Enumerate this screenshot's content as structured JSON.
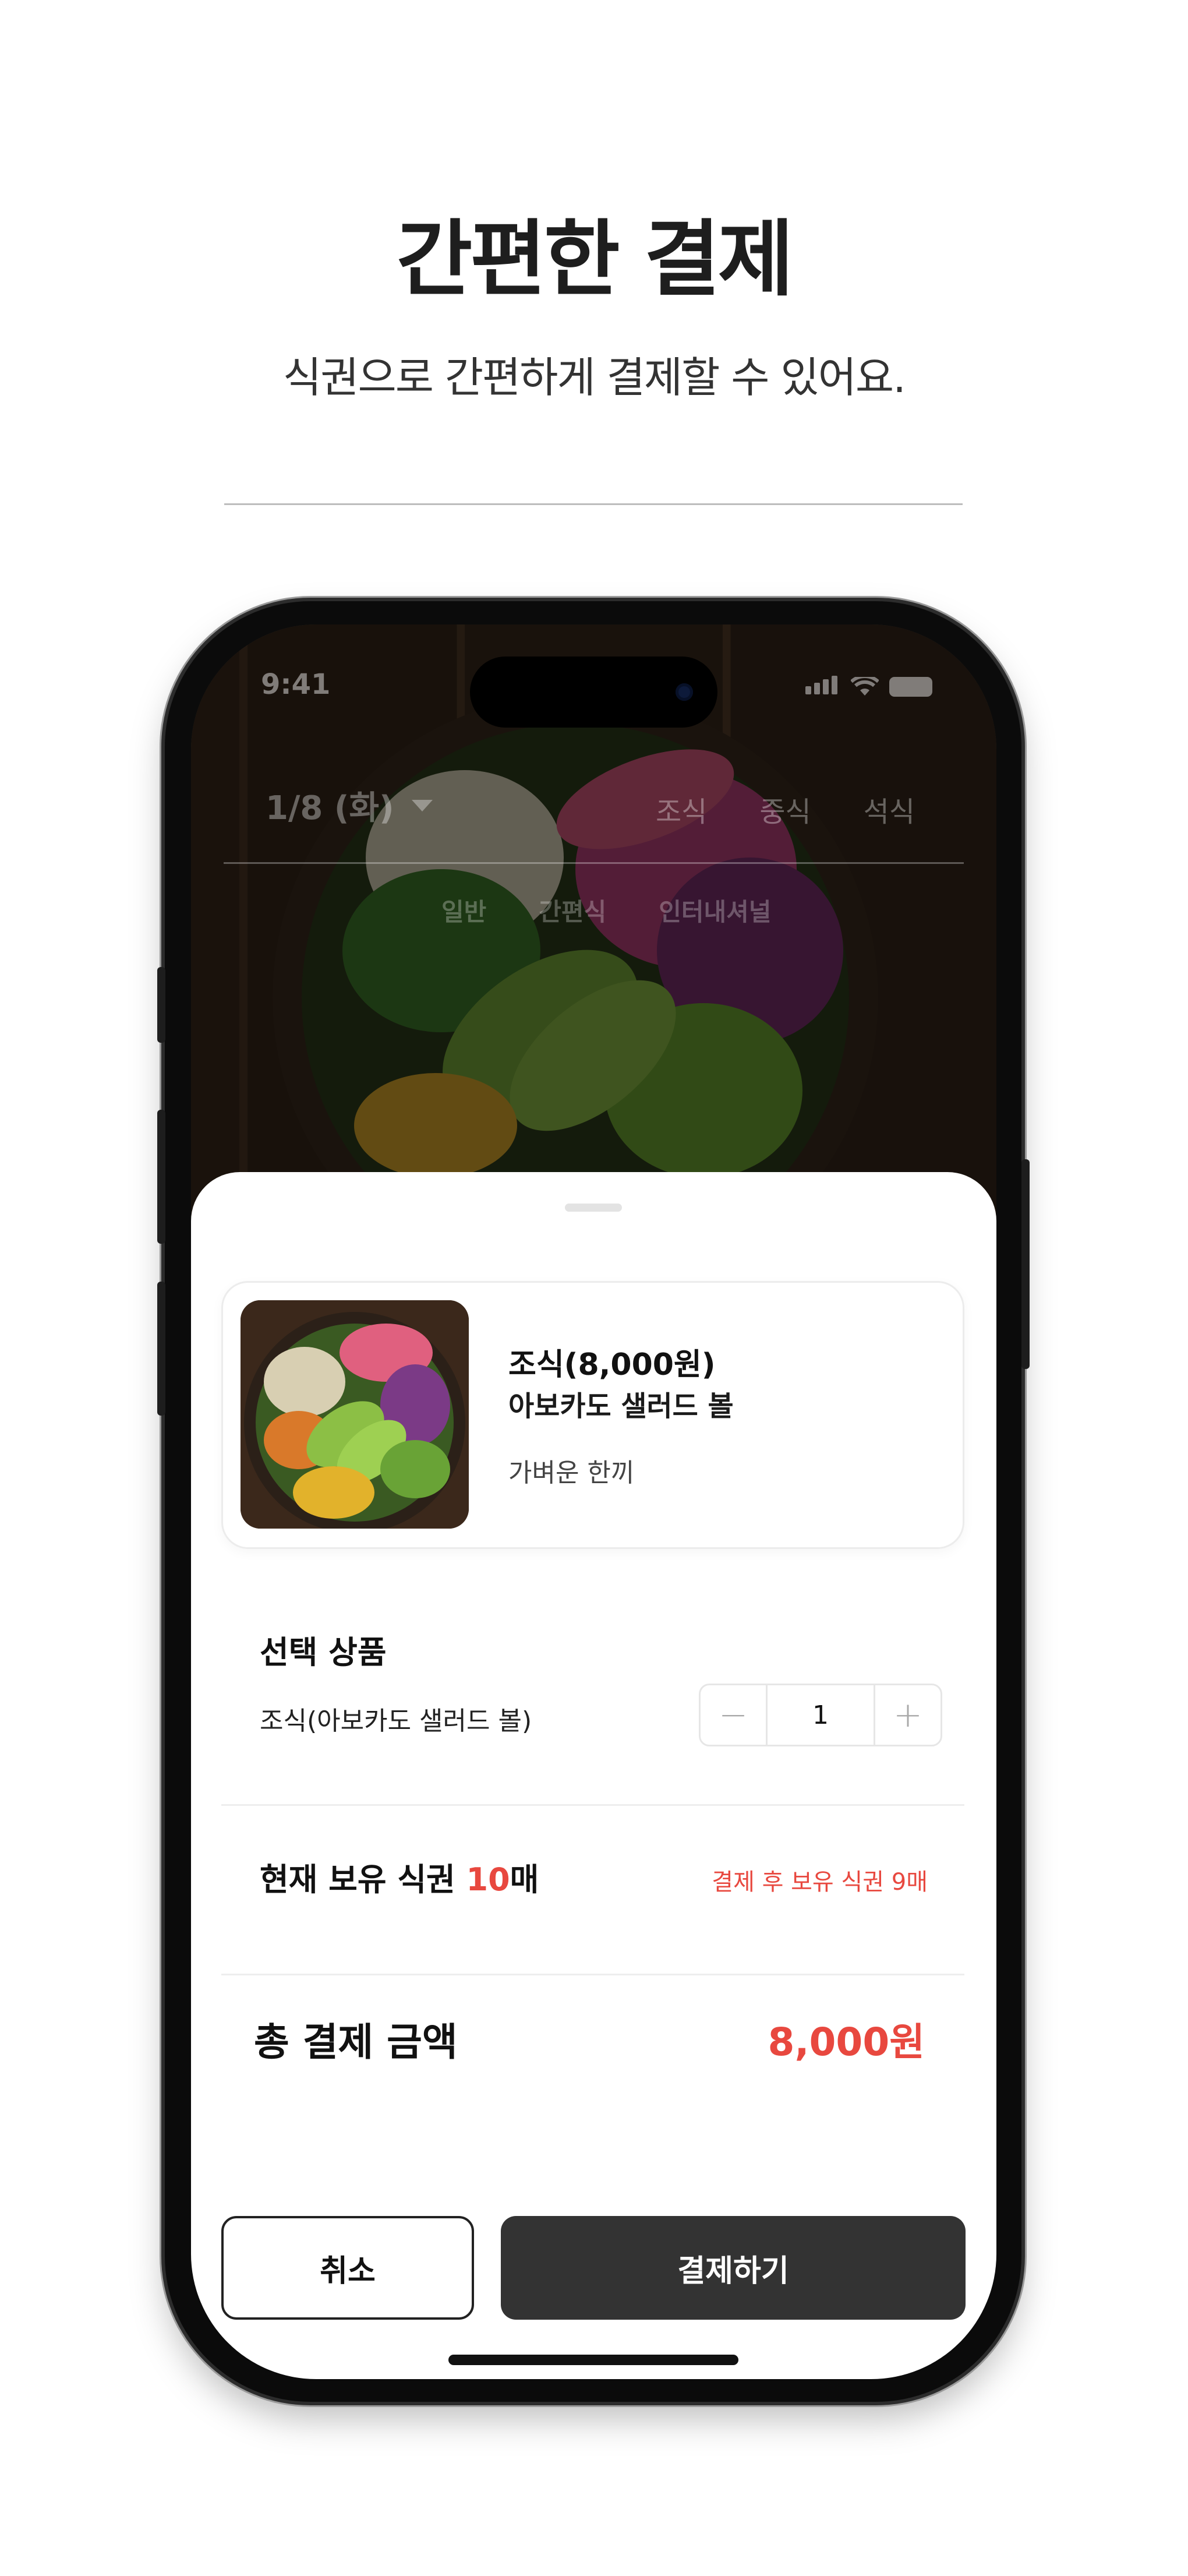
{
  "hero": {
    "title": "간편한 결제",
    "subtitle": "식권으로 간편하게 결제할 수 있어요."
  },
  "status_bar": {
    "time": "9:41",
    "icons": [
      "signal-icon",
      "wifi-icon",
      "battery-icon"
    ]
  },
  "app_header": {
    "date": "1/8 (화)",
    "meal_tabs": [
      "조식",
      "중식",
      "석식"
    ],
    "sub_tabs": [
      "일반",
      "간편식",
      "인터내셔널"
    ]
  },
  "sheet": {
    "product": {
      "meal": "조식(8,000원)",
      "name": "아보카도 샐러드 볼",
      "description": "가벼운 한끼"
    },
    "selection": {
      "title": "선택 상품",
      "item": "조식(아보카도 샐러드 볼)",
      "quantity": "1",
      "minus_icon": "minus-icon",
      "plus_icon": "plus-icon"
    },
    "voucher": {
      "label": "현재 보유 식권",
      "count": "10",
      "unit": "매",
      "after_payment": "결제 후 보유 식권 9매"
    },
    "total": {
      "label": "총 결제 금액",
      "value": "8,000원"
    },
    "buttons": {
      "cancel": "취소",
      "pay": "결제하기"
    }
  },
  "colors": {
    "accent_red": "#e8483f",
    "pay_button": "#333333",
    "text_primary": "#111111"
  }
}
